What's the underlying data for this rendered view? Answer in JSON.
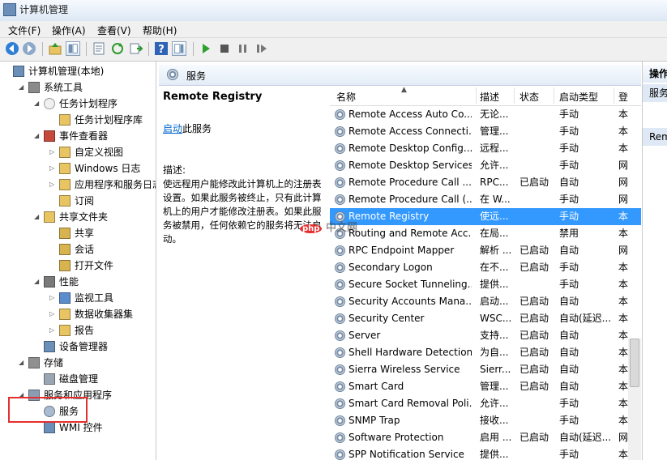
{
  "window": {
    "title": "计算机管理"
  },
  "menu": [
    "文件(F)",
    "操作(A)",
    "查看(V)",
    "帮助(H)"
  ],
  "tree": [
    {
      "label": "计算机管理(本地)",
      "icon": "computer-icon"
    },
    {
      "label": "系统工具",
      "icon": "tools-icon"
    },
    {
      "label": "任务计划程序",
      "icon": "clock-icon"
    },
    {
      "label": "任务计划程序库",
      "icon": "folder-icon"
    },
    {
      "label": "事件查看器",
      "icon": "event-viewer-icon"
    },
    {
      "label": "自定义视图",
      "icon": "folder-icon"
    },
    {
      "label": "Windows 日志",
      "icon": "folder-icon"
    },
    {
      "label": "应用程序和服务日志",
      "icon": "folder-icon"
    },
    {
      "label": "订阅",
      "icon": "subscription-icon"
    },
    {
      "label": "共享文件夹",
      "icon": "shared-folder-icon"
    },
    {
      "label": "共享",
      "icon": "share-icon"
    },
    {
      "label": "会话",
      "icon": "session-icon"
    },
    {
      "label": "打开文件",
      "icon": "open-file-icon"
    },
    {
      "label": "性能",
      "icon": "performance-icon"
    },
    {
      "label": "监视工具",
      "icon": "monitor-icon"
    },
    {
      "label": "数据收集器集",
      "icon": "collector-icon"
    },
    {
      "label": "报告",
      "icon": "report-icon"
    },
    {
      "label": "设备管理器",
      "icon": "device-manager-icon"
    },
    {
      "label": "存储",
      "icon": "storage-icon"
    },
    {
      "label": "磁盘管理",
      "icon": "disk-icon"
    },
    {
      "label": "服务和应用程序",
      "icon": "services-apps-icon"
    },
    {
      "label": "服务",
      "icon": "gear-icon"
    },
    {
      "label": "WMI 控件",
      "icon": "wmi-icon"
    }
  ],
  "panel": {
    "title": "服务"
  },
  "desc": {
    "service_name": "Remote Registry",
    "start_link": "启动",
    "start_suffix": "此服务",
    "desc_label": "描述:",
    "desc_text": "使远程用户能修改此计算机上的注册表设置。如果此服务被终止，只有此计算机上的用户才能修改注册表。如果此服务被禁用，任何依赖它的服务将无法启动。"
  },
  "columns": [
    "名称",
    "描述",
    "状态",
    "启动类型",
    "登"
  ],
  "services": [
    {
      "name": "Remote Access Auto Co...",
      "desc": "无论...",
      "status": "",
      "startup": "手动",
      "logon": "本"
    },
    {
      "name": "Remote Access Connecti...",
      "desc": "管理...",
      "status": "",
      "startup": "手动",
      "logon": "本"
    },
    {
      "name": "Remote Desktop Config...",
      "desc": "远程...",
      "status": "",
      "startup": "手动",
      "logon": "本"
    },
    {
      "name": "Remote Desktop Services",
      "desc": "允许...",
      "status": "",
      "startup": "手动",
      "logon": "网"
    },
    {
      "name": "Remote Procedure Call ...",
      "desc": "RPC...",
      "status": "已启动",
      "startup": "自动",
      "logon": "网"
    },
    {
      "name": "Remote Procedure Call (...",
      "desc": "在 W...",
      "status": "",
      "startup": "手动",
      "logon": "网"
    },
    {
      "name": "Remote Registry",
      "desc": "使远...",
      "status": "",
      "startup": "手动",
      "logon": "本"
    },
    {
      "name": "Routing and Remote Acc...",
      "desc": "在局...",
      "status": "",
      "startup": "禁用",
      "logon": "本"
    },
    {
      "name": "RPC Endpoint Mapper",
      "desc": "解析 ...",
      "status": "已启动",
      "startup": "自动",
      "logon": "网"
    },
    {
      "name": "Secondary Logon",
      "desc": "在不...",
      "status": "已启动",
      "startup": "手动",
      "logon": "本"
    },
    {
      "name": "Secure Socket Tunneling...",
      "desc": "提供...",
      "status": "",
      "startup": "手动",
      "logon": "本"
    },
    {
      "name": "Security Accounts Mana...",
      "desc": "启动...",
      "status": "已启动",
      "startup": "自动",
      "logon": "本"
    },
    {
      "name": "Security Center",
      "desc": "WSC...",
      "status": "已启动",
      "startup": "自动(延迟...",
      "logon": "本"
    },
    {
      "name": "Server",
      "desc": "支持...",
      "status": "已启动",
      "startup": "自动",
      "logon": "本"
    },
    {
      "name": "Shell Hardware Detection",
      "desc": "为自...",
      "status": "已启动",
      "startup": "自动",
      "logon": "本"
    },
    {
      "name": "Sierra Wireless Service",
      "desc": "Sierr...",
      "status": "已启动",
      "startup": "自动",
      "logon": "本"
    },
    {
      "name": "Smart Card",
      "desc": "管理...",
      "status": "已启动",
      "startup": "自动",
      "logon": "本"
    },
    {
      "name": "Smart Card Removal Poli...",
      "desc": "允许...",
      "status": "",
      "startup": "手动",
      "logon": "本"
    },
    {
      "name": "SNMP Trap",
      "desc": "接收...",
      "status": "",
      "startup": "手动",
      "logon": "本"
    },
    {
      "name": "Software Protection",
      "desc": "启用 ...",
      "status": "已启动",
      "startup": "自动(延迟...",
      "logon": "网"
    },
    {
      "name": "SPP Notification Service",
      "desc": "提供...",
      "status": "",
      "startup": "手动",
      "logon": "本"
    }
  ],
  "selected_index": 6,
  "actions": {
    "title": "操作",
    "section": "服务",
    "item": "Rem"
  },
  "watermark": {
    "badge": "php",
    "text": "中文网"
  },
  "colors": {
    "selection": "#3399ff",
    "link": "#0066cc",
    "highlight_box": "#e52e2e"
  }
}
